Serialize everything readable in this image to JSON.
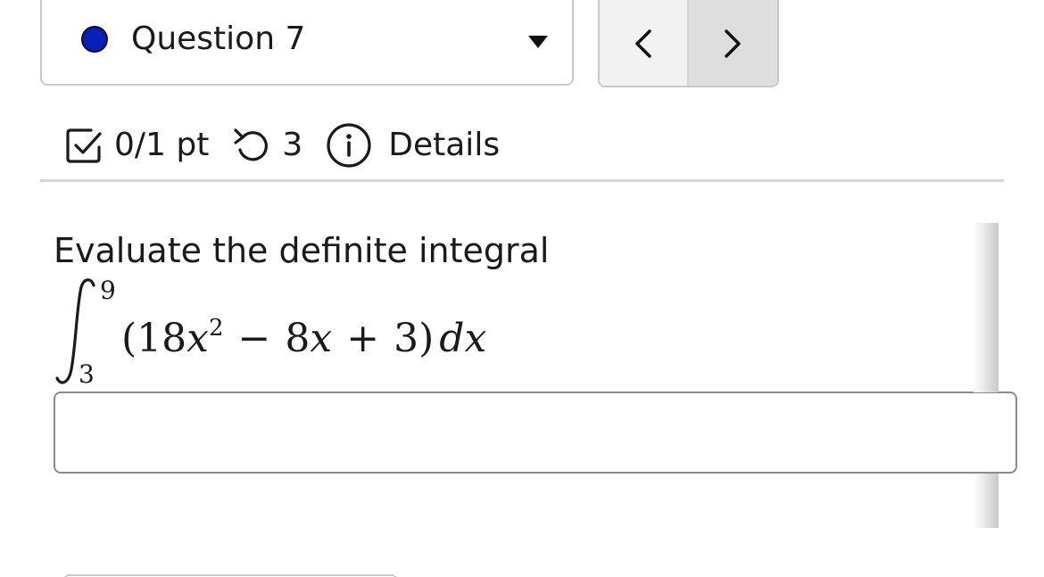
{
  "question_selector": {
    "label": "Question 7",
    "status_color": "#0a1fb5"
  },
  "nav": {
    "prev_icon": "chevron-left-icon",
    "next_icon": "chevron-right-icon"
  },
  "status_row": {
    "score": "0/1 pt",
    "attempts": "3",
    "details": "Details"
  },
  "question": {
    "prompt": "Evaluate the definite integral",
    "integral": {
      "upper_limit": "9",
      "lower_limit": "3",
      "coef_a": "18",
      "var": "x",
      "exponent": "2",
      "op1": "−",
      "coef_b": "8",
      "op2": "+",
      "constant": "3",
      "differential": "dx"
    }
  },
  "answer": {
    "value": "",
    "placeholder": ""
  }
}
